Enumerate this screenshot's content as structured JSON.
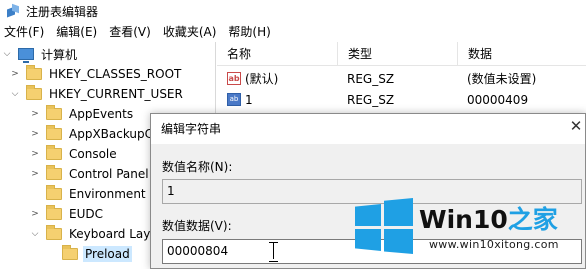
{
  "window": {
    "title": "注册表编辑器",
    "icon": "registry-editor-icon"
  },
  "menu": [
    "文件(F)",
    "编辑(E)",
    "查看(V)",
    "收藏夹(A)",
    "帮助(H)"
  ],
  "tree": {
    "root": "计算机",
    "keys": [
      {
        "label": "HKEY_CLASSES_ROOT",
        "expanded": false
      },
      {
        "label": "HKEY_CURRENT_USER",
        "expanded": true
      }
    ],
    "children": [
      "AppEvents",
      "AppXBackupC",
      "Console",
      "Control Panel",
      "Environment",
      "EUDC",
      "Keyboard Lay"
    ],
    "selected": "Preload"
  },
  "list": {
    "headers": {
      "name": "名称",
      "type": "类型",
      "data": "数据"
    },
    "rows": [
      {
        "icon": "ab",
        "name": "(默认)",
        "type": "REG_SZ",
        "data": "(数值未设置)"
      },
      {
        "icon": "bin",
        "name": "1",
        "type": "REG_SZ",
        "data": "00000409"
      }
    ]
  },
  "dialog": {
    "title": "编辑字符串",
    "name_label": "数值名称(N):",
    "name_value": "1",
    "data_label": "数值数据(V):",
    "data_value": "00000804"
  },
  "watermark": {
    "brand_prefix": "Win10",
    "brand_suffix": "之家",
    "url": "www.win10xitong.com",
    "color": "#1fa0e4"
  }
}
